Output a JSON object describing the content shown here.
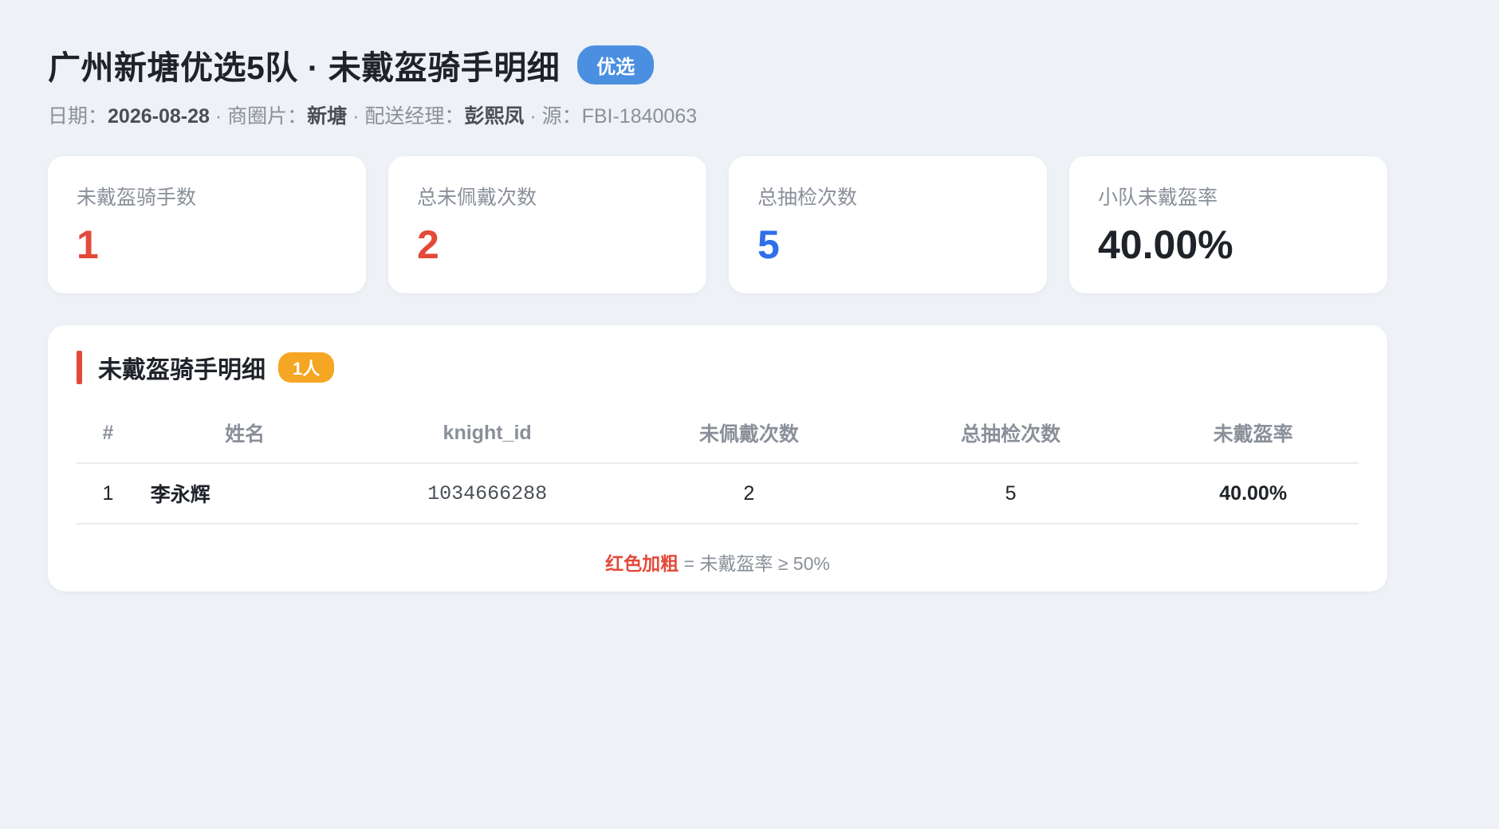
{
  "header": {
    "title": "广州新塘优选5队 · 未戴盔骑手明细",
    "badge": "优选",
    "date_label": "日期：",
    "date": "2026-08-28",
    "sep1": " · 商圈片：",
    "area": "新塘",
    "sep2": " · 配送经理：",
    "manager": "彭熙凤",
    "sep3": " · 源：",
    "source": "FBI-1840063"
  },
  "stats": [
    {
      "label": "未戴盔骑手数",
      "value": "1",
      "color": "#e34a3a"
    },
    {
      "label": "总未佩戴次数",
      "value": "2",
      "color": "#e34a3a"
    },
    {
      "label": "总抽检次数",
      "value": "5",
      "color": "#2f6fe8"
    },
    {
      "label": "小队未戴盔率",
      "value": "40.00%",
      "color": "#1f2329"
    }
  ],
  "panel": {
    "title": "未戴盔骑手明细",
    "count_badge": "1人",
    "columns": [
      "#",
      "姓名",
      "knight_id",
      "未佩戴次数",
      "总抽检次数",
      "未戴盔率"
    ],
    "rows": [
      {
        "index": "1",
        "name": "李永辉",
        "knight_id": "1034666288",
        "no_helmet": "2",
        "checks": "5",
        "rate": "40.00%"
      }
    ],
    "legend_red": "红色加粗",
    "legend_rest": " = 未戴盔率 ≥ 50%"
  }
}
